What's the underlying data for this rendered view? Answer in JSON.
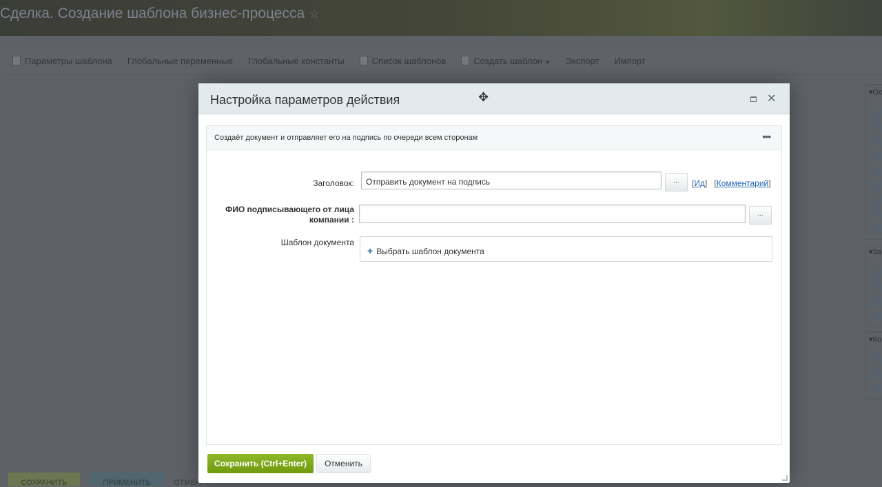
{
  "page": {
    "title": "Сделка. Создание шаблона бизнес-процесса",
    "star_icon": "star-icon"
  },
  "toolbar": {
    "items": [
      "Параметры шаблона",
      "Глобальные переменные",
      "Глобальные константы",
      "Список шаблонов",
      "Создать шаблон",
      "Экспорт",
      "Импорт"
    ]
  },
  "right_panel": {
    "sections": [
      "Ос",
      "За",
      "Ко"
    ]
  },
  "bottom_buttons": {
    "save": "СОХРАНИТЬ",
    "apply": "ПРИМЕНИТЬ",
    "cancel": "ОТМЕНИТЬ"
  },
  "dialog": {
    "title": "Настройка параметров действия",
    "description": "Создаёт документ и отправляет его на подпись по очереди всем сторонам",
    "more": "•••",
    "fields": {
      "title_label": "Заголовок:",
      "title_value": "Отправить документ на подпись",
      "id_link": "Ид",
      "comment_link": "Комментарий",
      "signer_label": "ФИО подписывающего от лица компании :",
      "signer_value": "",
      "template_label": "Шаблон документа",
      "template_action": "Выбрать шаблон документа"
    },
    "dots_button": "...",
    "save": "Сохранить (Ctrl+Enter)",
    "cancel": "Отменить"
  },
  "colors": {
    "accent_green": "#7ea61b",
    "link": "#2067b0",
    "overlay": "#5e6267"
  }
}
